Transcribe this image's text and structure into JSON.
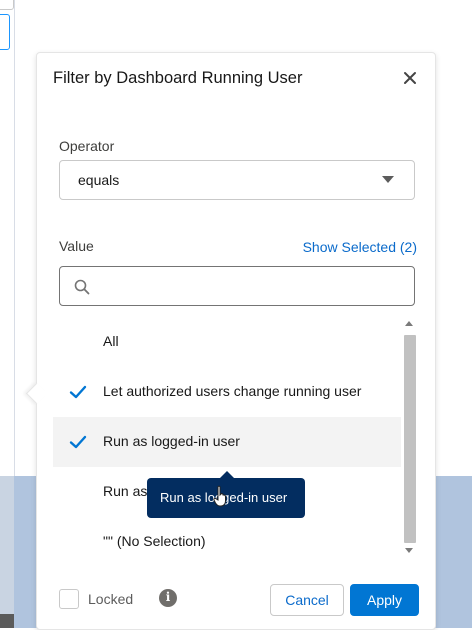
{
  "popover": {
    "title": "Filter by Dashboard Running User",
    "operator_label": "Operator",
    "operator_value": "equals",
    "value_label": "Value",
    "show_selected": "Show Selected (2)",
    "search_placeholder": "",
    "options": [
      {
        "label": "All",
        "checked": false
      },
      {
        "label": "Let authorized users change running user",
        "checked": true
      },
      {
        "label": "Run as logged-in user",
        "checked": true
      },
      {
        "label": "Run as",
        "checked": false
      },
      {
        "label": "\"\" (No Selection)",
        "checked": false
      }
    ],
    "tooltip": "Run as logged-in user",
    "locked_label": "Locked",
    "info_glyph": "i",
    "cancel_label": "Cancel",
    "apply_label": "Apply"
  },
  "colors": {
    "accent": "#0176d3",
    "link": "#0b6bcb",
    "tooltip_bg": "#032d60",
    "background_band": "#b0c4de"
  },
  "icons": [
    "close-icon",
    "chevron-down-icon",
    "search-icon",
    "checkmark-icon",
    "info-icon",
    "scroll-up-icon",
    "scroll-down-icon",
    "cursor-icon"
  ]
}
